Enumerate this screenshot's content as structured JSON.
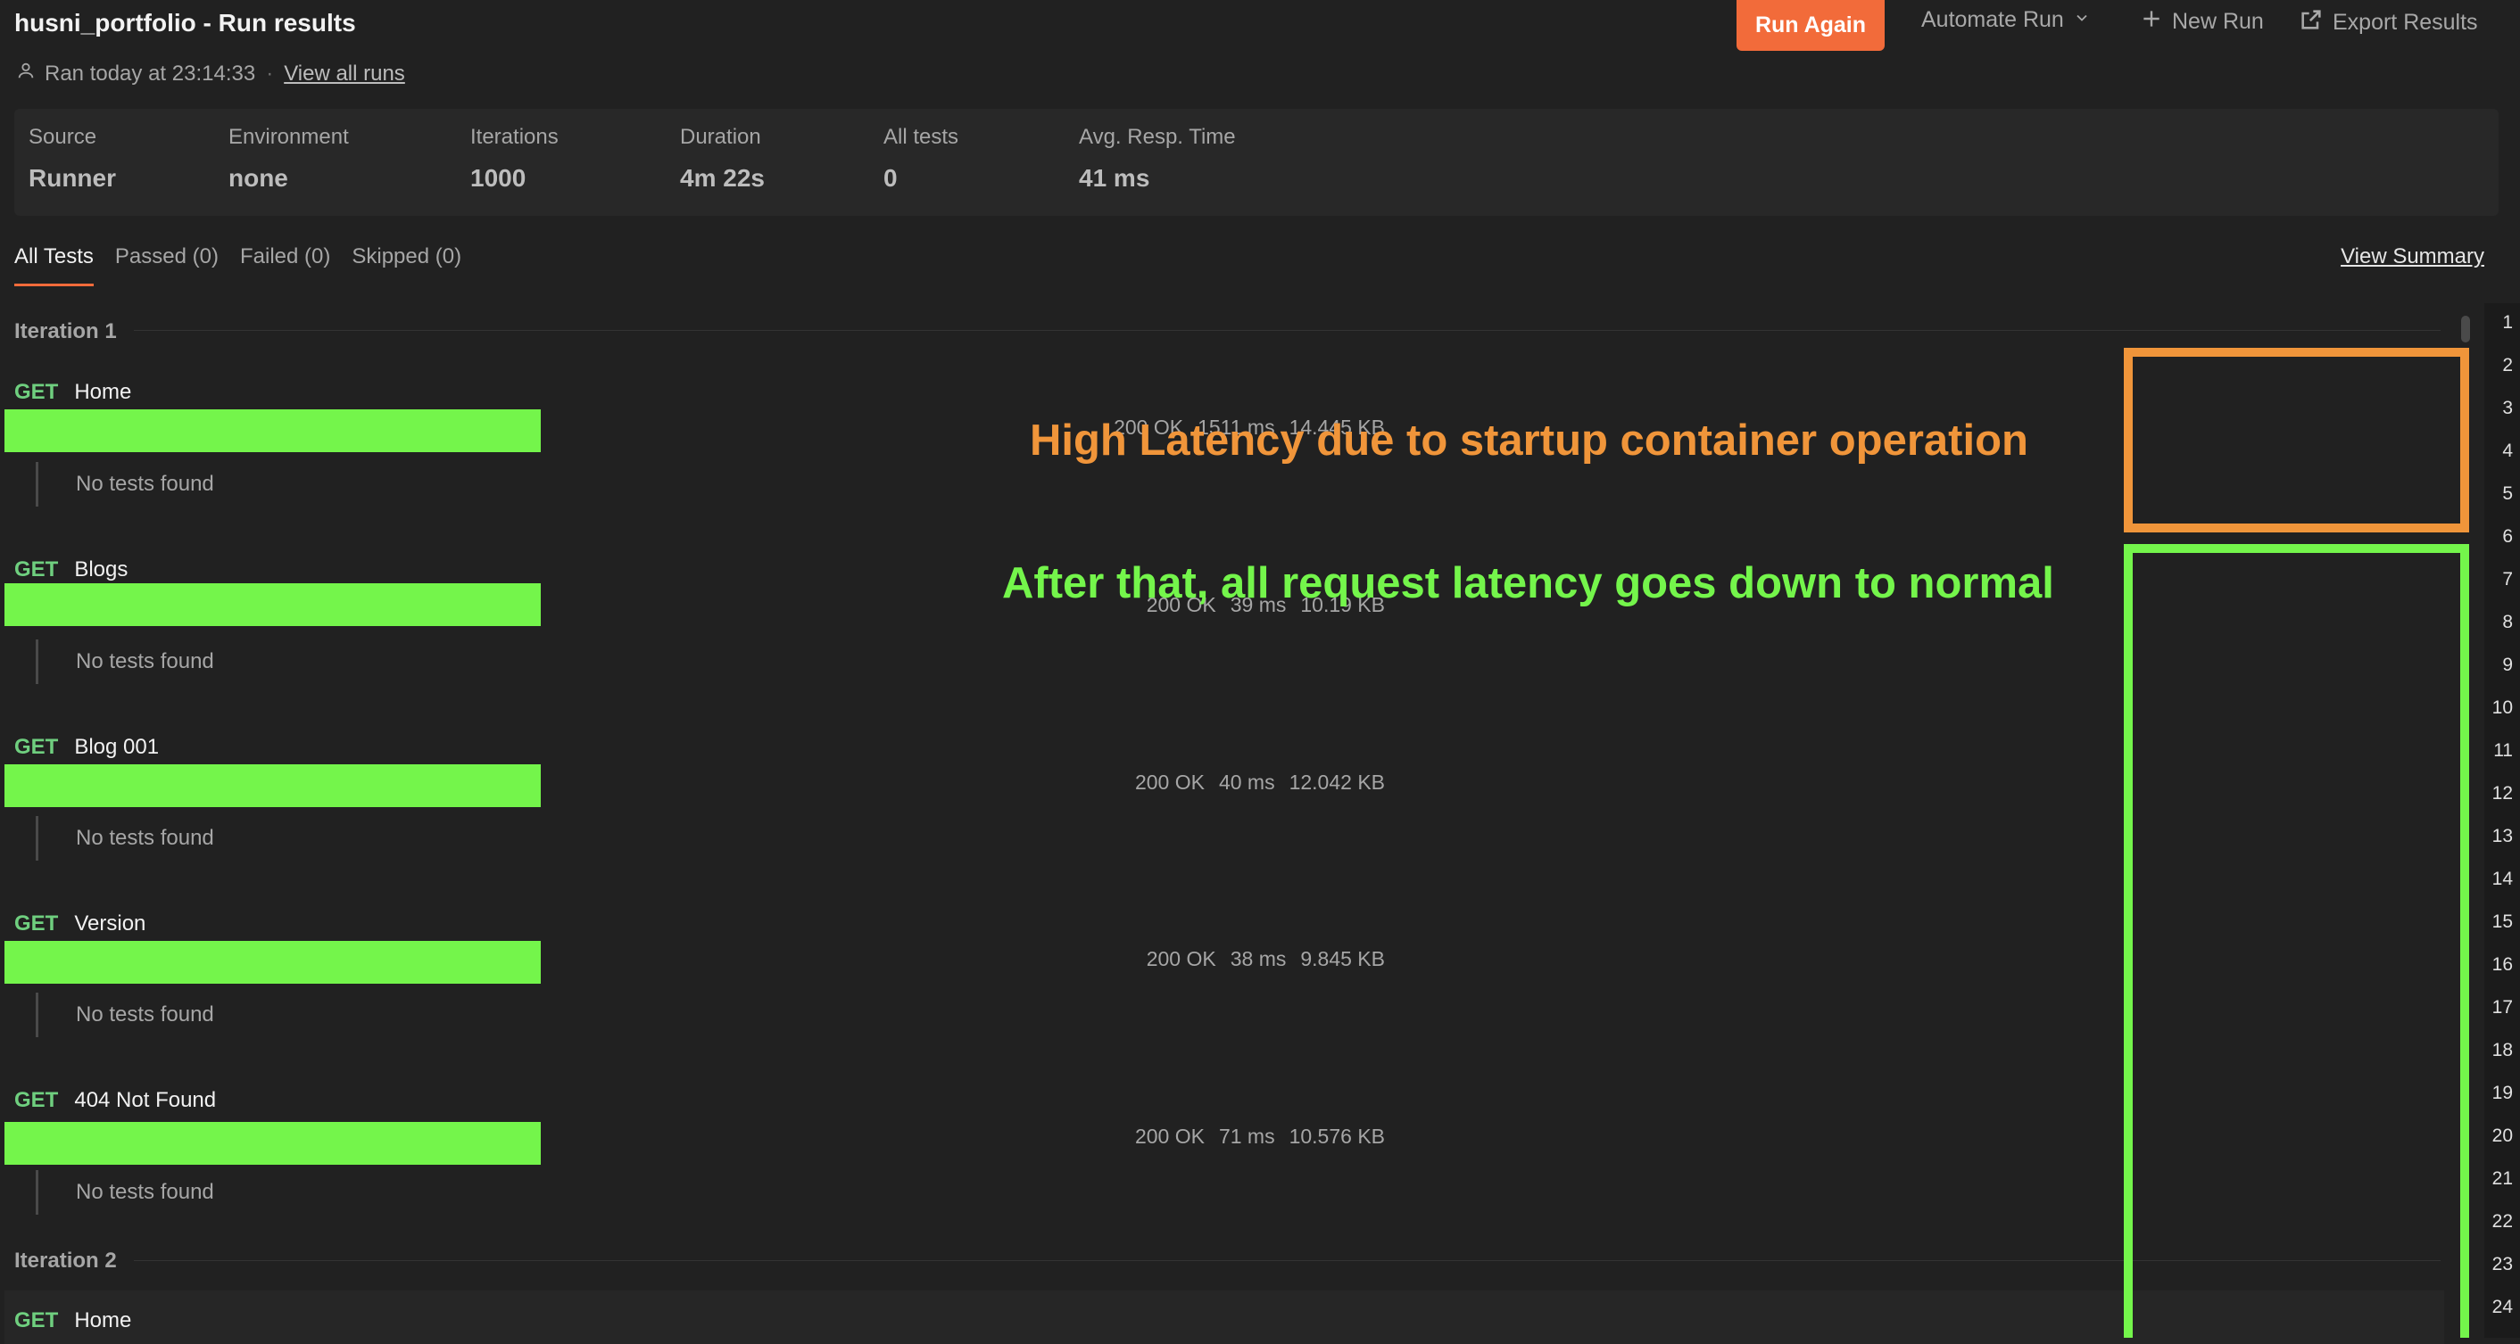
{
  "header": {
    "title": "husni_portfolio - Run results",
    "ran_text": "Ran today at 23:14:33",
    "separator": "·",
    "view_all_runs": "View all runs",
    "run_again": "Run Again",
    "automate_run": "Automate Run",
    "new_run": "New Run",
    "export_results": "Export Results"
  },
  "stats": [
    {
      "label": "Source",
      "value": "Runner"
    },
    {
      "label": "Environment",
      "value": "none"
    },
    {
      "label": "Iterations",
      "value": "1000"
    },
    {
      "label": "Duration",
      "value": "4m 22s"
    },
    {
      "label": "All tests",
      "value": "0"
    },
    {
      "label": "Avg. Resp. Time",
      "value": "41 ms"
    }
  ],
  "tabs": [
    {
      "label": "All Tests",
      "active": true
    },
    {
      "label": "Passed (0)"
    },
    {
      "label": "Failed (0)"
    },
    {
      "label": "Skipped (0)"
    }
  ],
  "view_summary": "View Summary",
  "iterations": [
    {
      "label": "Iteration 1",
      "requests": [
        {
          "method": "GET",
          "name": "Home",
          "no_tests": "No tests found",
          "status": "200 OK",
          "time": "1511 ms",
          "size": "14.445 KB"
        },
        {
          "method": "GET",
          "name": "Blogs",
          "no_tests": "No tests found",
          "status": "200 OK",
          "time": "39 ms",
          "size": "10.19 KB"
        },
        {
          "method": "GET",
          "name": "Blog 001",
          "no_tests": "No tests found",
          "status": "200 OK",
          "time": "40 ms",
          "size": "12.042 KB"
        },
        {
          "method": "GET",
          "name": "Version",
          "no_tests": "No tests found",
          "status": "200 OK",
          "time": "38 ms",
          "size": "9.845 KB"
        },
        {
          "method": "GET",
          "name": "404 Not Found",
          "no_tests": "No tests found",
          "status": "200 OK",
          "time": "71 ms",
          "size": "10.576 KB"
        }
      ]
    },
    {
      "label": "Iteration 2",
      "requests": [
        {
          "method": "GET",
          "name": "Home"
        }
      ]
    }
  ],
  "annotations": {
    "orange_text": "High Latency due to startup container operation",
    "green_text": "After that, all request latency goes down to normal",
    "orange_color": "#f0953a",
    "green_color": "#74f54b"
  },
  "gutter_numbers": [
    "1",
    "2",
    "3",
    "4",
    "5",
    "6",
    "7",
    "8",
    "9",
    "10",
    "11",
    "12",
    "13",
    "14",
    "15",
    "16",
    "17",
    "18",
    "19",
    "20",
    "21",
    "22",
    "23",
    "24"
  ],
  "colors": {
    "accent": "#f26b3a",
    "background": "#212121",
    "method_get": "#6fcf7f"
  }
}
